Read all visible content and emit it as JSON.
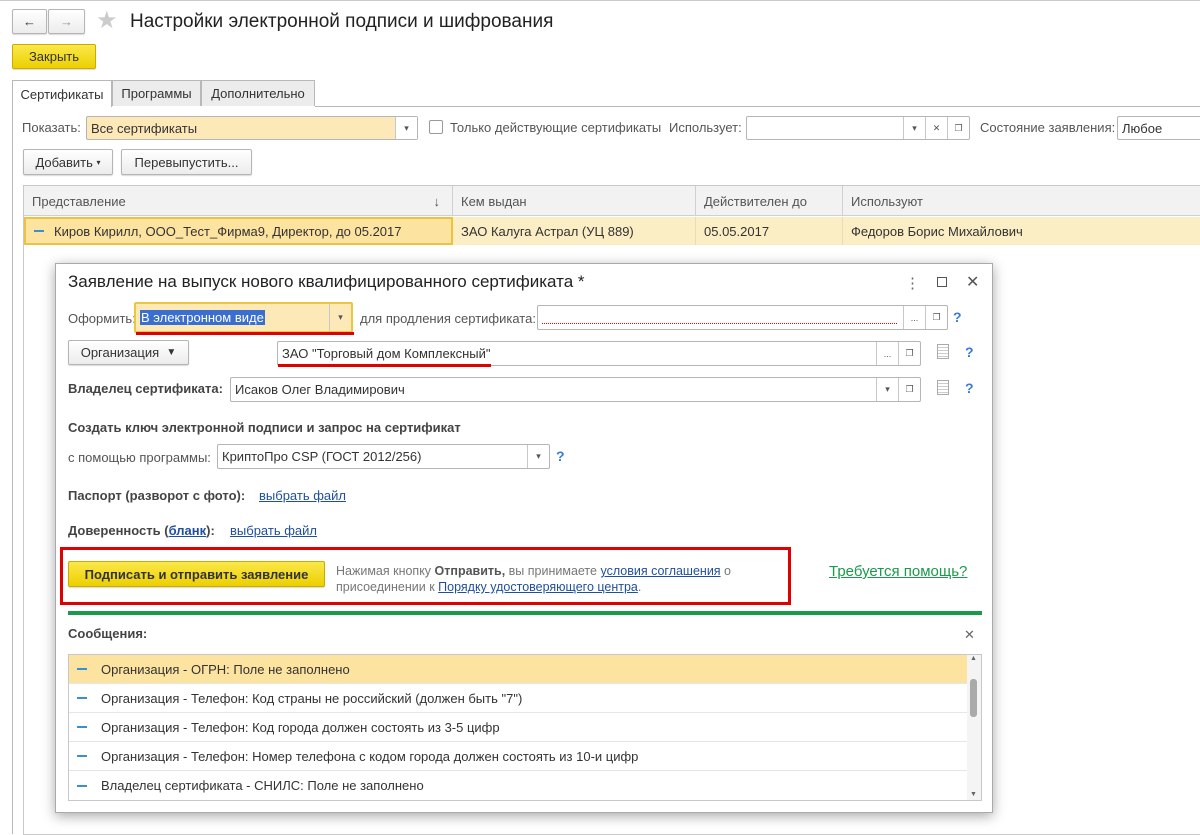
{
  "window": {
    "title": "Настройки электронной подписи и шифрования",
    "close_label": "Закрыть"
  },
  "tabs": [
    {
      "label": "Сертификаты"
    },
    {
      "label": "Программы"
    },
    {
      "label": "Дополнительно"
    }
  ],
  "filters": {
    "show_label": "Показать:",
    "show_value": "Все сертификаты",
    "only_valid_label": "Только действующие сертификаты",
    "uses_label": "Использует:",
    "uses_value": "",
    "state_label": "Состояние заявления:",
    "state_value": "Любое"
  },
  "toolbar": {
    "add_label": "Добавить",
    "reissue_label": "Перевыпустить..."
  },
  "table": {
    "columns": [
      "Представление",
      "Кем выдан",
      "Действителен до",
      "Используют"
    ],
    "rows": [
      [
        "Киров Кирилл, ООО_Тест_Фирма9, Директор, до 05.2017",
        "ЗАО Калуга Астрал (УЦ 889)",
        "05.05.2017",
        "Федоров Борис Михайлович"
      ]
    ]
  },
  "dialog": {
    "title": "Заявление на выпуск нового квалифицированного сертификата *",
    "form_label": "Оформить:",
    "form_value": "В электронном виде",
    "renew_label": "для продления сертификата:",
    "renew_value": "",
    "org_button": "Организация",
    "org_value": "ЗАО \"Торговый дом Комплексный\"",
    "owner_label": "Владелец сертификата:",
    "owner_value": "Исаков Олег Владимирович",
    "create_key_heading": "Создать ключ электронной подписи и запрос на сертификат",
    "program_label": "с помощью программы:",
    "program_value": "КриптоПро CSP (ГОСТ 2012/256)",
    "passport_label": "Паспорт (разворот с фото):",
    "passport_link": "выбрать файл",
    "proxy_label_start": "Доверенность (",
    "proxy_blank": "бланк",
    "proxy_label_end": "):",
    "proxy_link": "выбрать файл",
    "submit_label": "Подписать и отправить заявление",
    "agree_1": "Нажимая кнопку ",
    "agree_bold": "Отправить,",
    "agree_2": " вы принимаете ",
    "agree_link1": "условия соглашения",
    "agree_3": " о присоединении к ",
    "agree_link2": "Порядку удостоверяющего центра",
    "agree_4": ".",
    "help_link": "Требуется помощь?",
    "messages_heading": "Сообщения:",
    "messages": [
      "Организация - ОГРН: Поле не заполнено",
      "Организация - Телефон: Код страны не российский (должен быть \"7\")",
      "Организация - Телефон: Код города должен состоять из 3-5 цифр",
      "Организация - Телефон: Номер телефона с кодом города должен состоять из 10-и цифр",
      "Владелец сертификата - СНИЛС: Поле не заполнено"
    ]
  },
  "colors": {
    "accent_yellow": "#f5dc1a",
    "highlight": "#fde8b8",
    "annotation_red": "#e00000",
    "green_bar": "#1a9a4a"
  }
}
